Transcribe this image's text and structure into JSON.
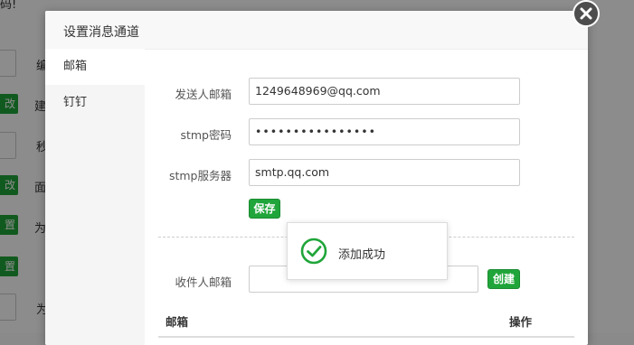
{
  "background": {
    "texts": [
      "编",
      "建",
      "秒",
      "面",
      "为",
      "为"
    ],
    "buttons": [
      "改",
      "改",
      "置",
      "置"
    ],
    "top_text": "码!"
  },
  "modal": {
    "title": "设置消息通道",
    "tabs": [
      {
        "label": "邮箱",
        "active": true
      },
      {
        "label": "钉钉",
        "active": false
      }
    ],
    "form": {
      "sender_label": "发送人邮箱",
      "sender_value": "1249648969@qq.com",
      "password_label": "stmp密码",
      "password_value": "••••••••••••••••",
      "server_label": "stmp服务器",
      "server_value": "smtp.qq.com",
      "save_label": "保存"
    },
    "recipient": {
      "label": "收件人邮箱",
      "value": "",
      "create_label": "创建"
    },
    "table": {
      "columns": [
        "邮箱",
        "操作"
      ]
    }
  },
  "toast": {
    "message": "添加成功"
  },
  "colors": {
    "accent": "#20a53a",
    "overlay": "rgba(0,0,0,0.45)"
  },
  "icons": {
    "close": "close-icon",
    "success": "check-circle-icon"
  }
}
